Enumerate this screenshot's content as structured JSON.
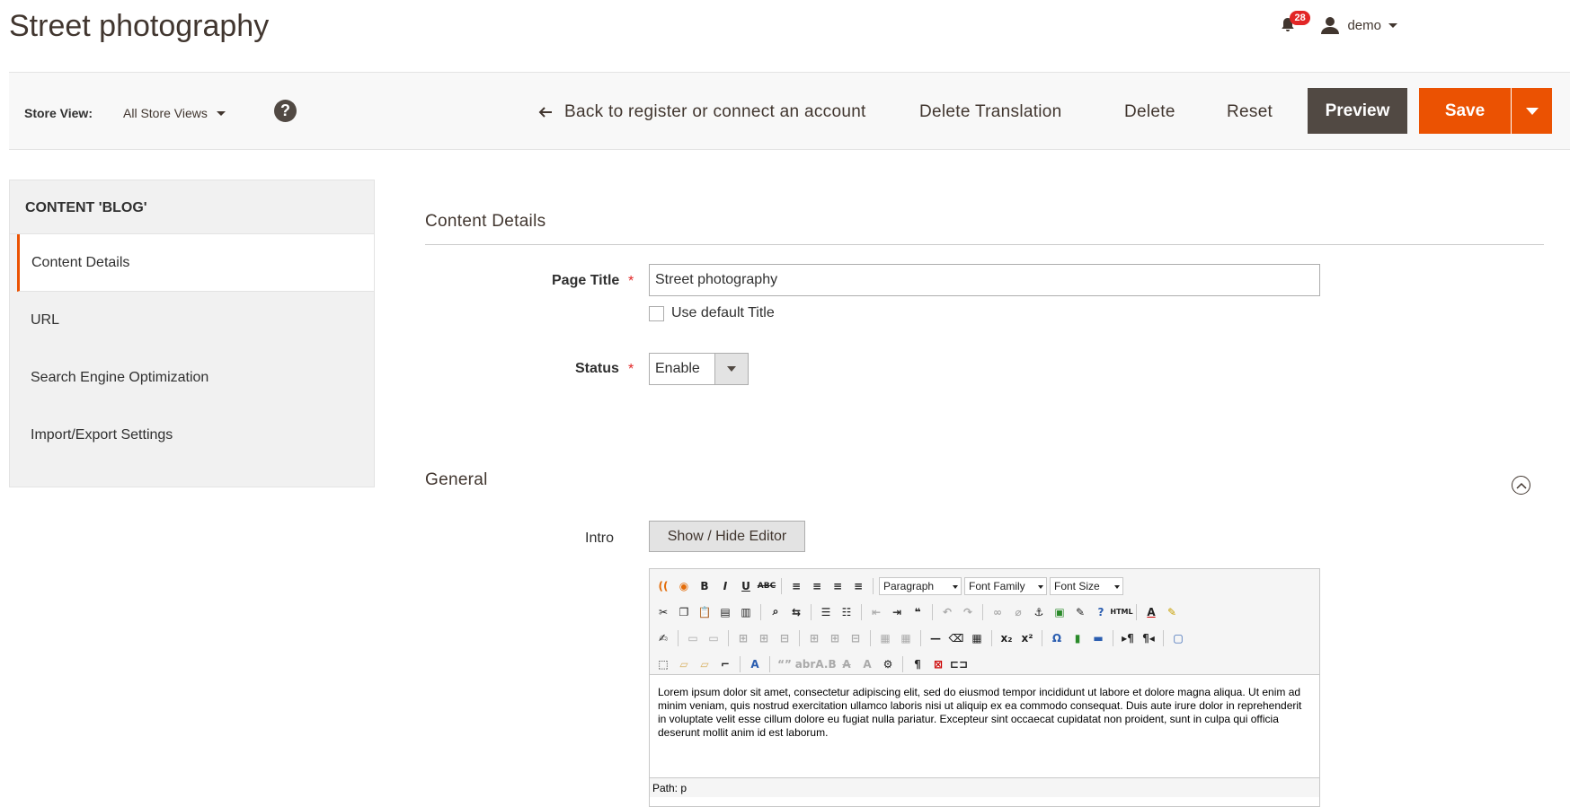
{
  "page": {
    "title": "Street photography"
  },
  "header": {
    "notifications_count": "28",
    "user_name": "demo"
  },
  "actionbar": {
    "store_view_label": "Store View:",
    "store_view_value": "All Store Views",
    "help": "?",
    "back_label": "Back to register or connect an account",
    "delete_translation_label": "Delete Translation",
    "delete_label": "Delete",
    "reset_label": "Reset",
    "preview_label": "Preview",
    "save_label": "Save"
  },
  "sidebar": {
    "title": "CONTENT 'BLOG'",
    "items": [
      {
        "label": "Content Details"
      },
      {
        "label": "URL"
      },
      {
        "label": "Search Engine Optimization"
      },
      {
        "label": "Import/Export Settings"
      }
    ]
  },
  "content_details": {
    "title": "Content Details",
    "page_title_label": "Page Title",
    "page_title_value": "Street photography",
    "use_default_label": "Use default Title",
    "status_label": "Status",
    "status_value": "Enable"
  },
  "general": {
    "title": "General",
    "intro_label": "Intro",
    "show_hide_label": "Show / Hide Editor",
    "toolbar": {
      "paragraph": "Paragraph",
      "font_family": "Font Family",
      "font_size": "Font Size"
    },
    "body_text": "Lorem ipsum dolor sit amet, consectetur adipiscing elit, sed do eiusmod tempor incididunt ut labore et dolore magna aliqua. Ut enim ad minim veniam, quis nostrud exercitation ullamco laboris nisi ut aliquip ex ea commodo consequat. Duis aute irure dolor in reprehenderit in voluptate velit esse cillum dolore eu fugiat nulla pariatur. Excepteur sint occaecat cupidatat non proident, sunt in culpa qui officia deserunt mollit anim id est laborum.",
    "path": "Path: p"
  },
  "colors": {
    "accent": "#eb5202",
    "dark": "#514943",
    "required": "#e22626"
  }
}
